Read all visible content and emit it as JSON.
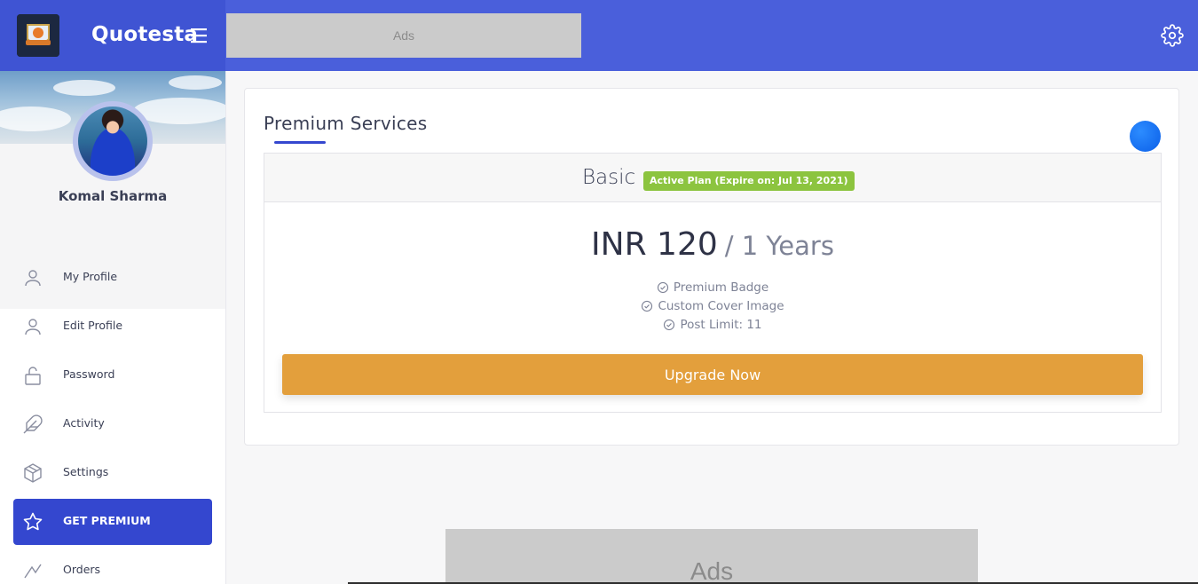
{
  "app": {
    "brand_name": "Quotesta",
    "ads_top": "Ads",
    "ads_bottom": "Ads"
  },
  "colors": {
    "topbar": "#4a5fdb",
    "accent": "#3447cf",
    "upgrade": "#e39f3c",
    "badge": "#8cc43f"
  },
  "user": {
    "name": "Komal Sharma"
  },
  "sidebar": {
    "items": [
      {
        "label": "My Profile",
        "icon": "user-icon"
      },
      {
        "label": "Edit Profile",
        "icon": "user-edit-icon"
      },
      {
        "label": "Password",
        "icon": "lock-icon"
      },
      {
        "label": "Activity",
        "icon": "feather-icon"
      },
      {
        "label": "Settings",
        "icon": "box-icon"
      },
      {
        "label": "GET PREMIUM",
        "icon": "star-icon",
        "active": true
      },
      {
        "label": "Orders",
        "icon": "orders-icon"
      }
    ]
  },
  "main": {
    "title": "Premium Services",
    "plan": {
      "name": "Basic",
      "badge": "Active Plan (Expire on: Jul 13, 2021)",
      "price": "INR 120",
      "period": "/ 1 Years",
      "features": [
        "Premium Badge",
        "Custom Cover Image",
        "Post Limit: 11"
      ],
      "cta": "Upgrade Now"
    }
  }
}
